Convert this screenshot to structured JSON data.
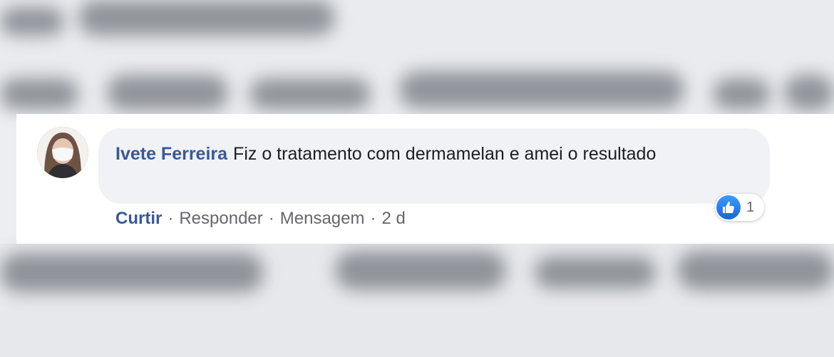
{
  "comment": {
    "author": "Ivete Ferreira",
    "text": "Fiz o tratamento com dermamelan e amei o resultado",
    "reaction_count": "1"
  },
  "actions": {
    "like": "Curtir",
    "sep": "·",
    "reply": "Responder",
    "message": "Mensagem",
    "time": "2 d"
  },
  "icons": {
    "avatar": "profile-photo-woman-with-mask",
    "reaction": "like-thumbs-up-icon"
  },
  "colors": {
    "author": "#385898",
    "bubble": "#f0f2f5",
    "like_badge": "#1877f2"
  }
}
